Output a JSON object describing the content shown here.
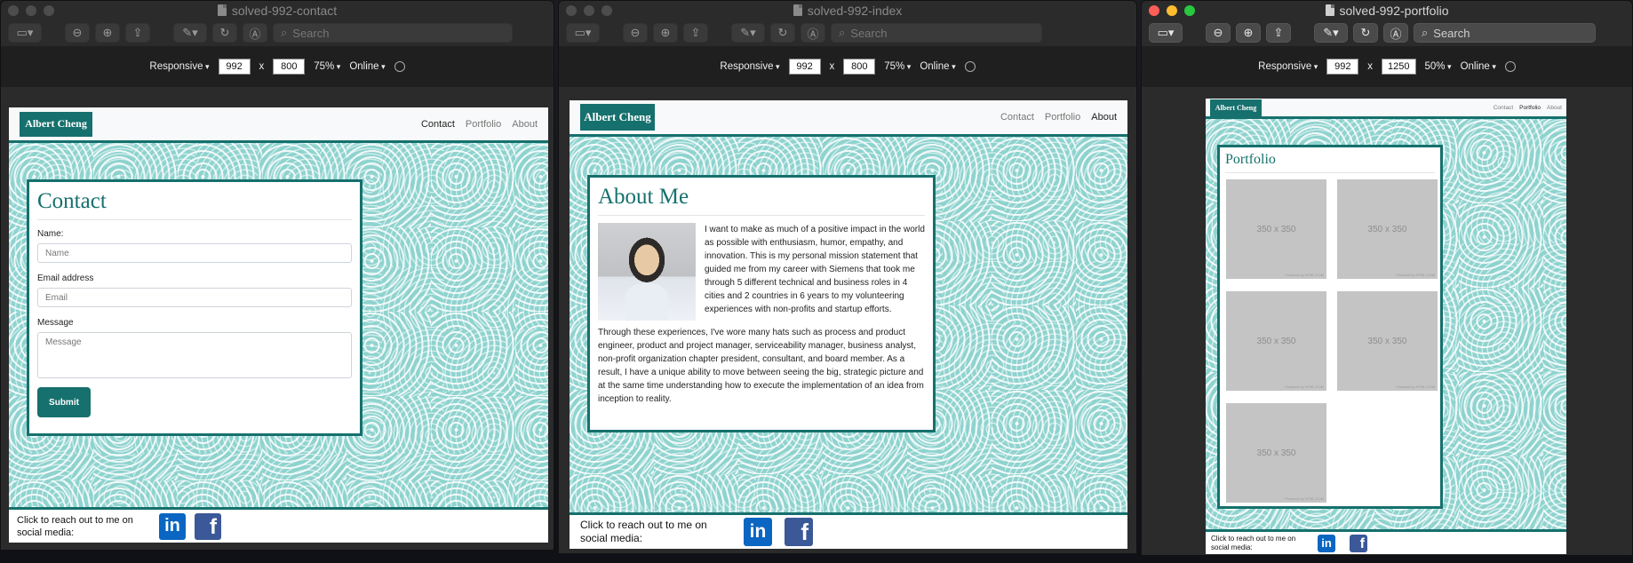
{
  "windows": [
    {
      "title": "solved-992-contact",
      "search_placeholder": "Search",
      "devbar": {
        "mode": "Responsive",
        "width": "992",
        "x": "x",
        "height": "800",
        "zoom": "75%",
        "network": "Online"
      },
      "site": {
        "brand": "Albert Cheng",
        "nav": [
          "Contact",
          "Portfolio",
          "About"
        ],
        "active_nav": "Contact",
        "card_title": "Contact",
        "form": {
          "name_label": "Name:",
          "name_placeholder": "Name",
          "email_label": "Email address",
          "email_placeholder": "Email",
          "message_label": "Message",
          "message_placeholder": "Message",
          "submit": "Submit"
        },
        "footer_text": "Click to reach out to me on social media:"
      }
    },
    {
      "title": "solved-992-index",
      "search_placeholder": "Search",
      "devbar": {
        "mode": "Responsive",
        "width": "992",
        "x": "x",
        "height": "800",
        "zoom": "75%",
        "network": "Online"
      },
      "site": {
        "brand": "Albert Cheng",
        "nav": [
          "Contact",
          "Portfolio",
          "About"
        ],
        "active_nav": "About",
        "card_title": "About Me",
        "para1": "I want to make as much of a positive impact in the world as possible with enthusiasm, humor, empathy, and innovation. This is my personal mission statement that guided me from my career with Siemens that took me through 5 different technical and business roles in 4 cities and 2 countries in 6 years to my volunteering experiences with non-profits and startup efforts.",
        "para2": "Through these experiences, I've wore many hats such as process and product engineer, product and project manager, serviceability manager, business analyst, non-profit organization chapter president, consultant, and board member. As a result, I have a unique ability to move between seeing the big, strategic picture and at the same time understanding how to execute the implementation of an idea from inception to reality.",
        "footer_text": "Click to reach out to me on social media:"
      }
    },
    {
      "title": "solved-992-portfolio",
      "search_placeholder": "Search",
      "devbar": {
        "mode": "Responsive",
        "width": "992",
        "x": "x",
        "height": "1250",
        "zoom": "50%",
        "network": "Online"
      },
      "site": {
        "brand": "Albert Cheng",
        "nav": [
          "Contact",
          "Portfolio",
          "About"
        ],
        "active_nav": "Portfolio",
        "card_title": "Portfolio",
        "placeholders": [
          "350 x 350",
          "350 x 350",
          "350 x 350",
          "350 x 350",
          "350 x 350"
        ],
        "placeholder_watermark": "Powered by HTML.COM",
        "footer_text": "Click to reach out to me on social media:"
      }
    }
  ],
  "icons": {
    "linkedin": "in",
    "facebook": "f"
  },
  "colors": {
    "teal": "#16706d",
    "pattern": "#8fd3cf",
    "linkedin": "#0a66c2",
    "facebook": "#3b5998"
  }
}
